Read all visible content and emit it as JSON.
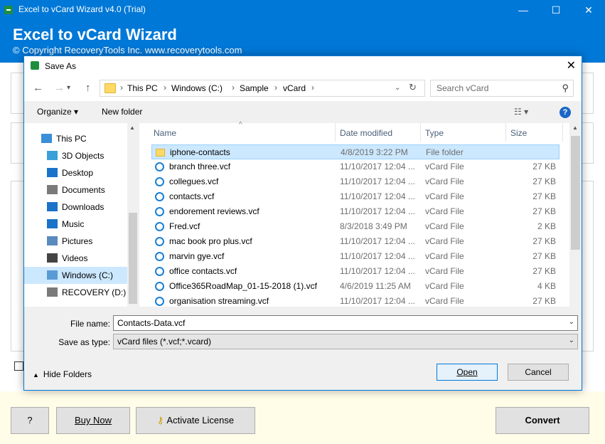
{
  "app": {
    "window_title": "Excel to vCard Wizard v4.0 (Trial)",
    "header_title": "Excel to vCard Wizard",
    "copyright": "© Copyright RecoveryTools Inc. www.recoverytools.com",
    "min_glyph": "—",
    "max_glyph": "☐",
    "close_glyph": "✕",
    "buttons": {
      "help": "?",
      "buy_now": "Buy Now",
      "activate_license": "Activate License",
      "convert": "Convert"
    }
  },
  "dialog": {
    "title": "Save As",
    "close_glyph": "✕",
    "nav": {
      "back": "←",
      "forward": "→",
      "up": "↑"
    },
    "breadcrumb": [
      "This PC",
      "Windows (C:)",
      "Sample",
      "vCard"
    ],
    "search_placeholder": "Search vCard",
    "toolbar": {
      "organize": "Organize ▾",
      "new_folder": "New folder",
      "view": "☷ ▾",
      "help": "?"
    },
    "nav_pane": [
      {
        "label": "This PC",
        "icon": "computer-icon",
        "color": "#3b8ed8"
      },
      {
        "label": "3D Objects",
        "icon": "cube-icon",
        "color": "#39a0d8"
      },
      {
        "label": "Desktop",
        "icon": "desktop-icon",
        "color": "#1a73c8"
      },
      {
        "label": "Documents",
        "icon": "document-icon",
        "color": "#7a7a7a"
      },
      {
        "label": "Downloads",
        "icon": "download-icon",
        "color": "#1a73c8"
      },
      {
        "label": "Music",
        "icon": "music-icon",
        "color": "#1a73c8"
      },
      {
        "label": "Pictures",
        "icon": "picture-icon",
        "color": "#5a8bbf"
      },
      {
        "label": "Videos",
        "icon": "video-icon",
        "color": "#444444"
      },
      {
        "label": "Windows (C:)",
        "icon": "drive-icon",
        "color": "#5b9bd5",
        "selected": true
      },
      {
        "label": "RECOVERY (D:)",
        "icon": "drive-icon",
        "color": "#7a7a7a"
      }
    ],
    "columns": {
      "name": "Name",
      "date": "Date modified",
      "type": "Type",
      "size": "Size"
    },
    "files": [
      {
        "name": "iphone-contacts",
        "date": "4/8/2019 3:22 PM",
        "type": "File folder",
        "size": "",
        "icon": "folder-icon",
        "selected": true
      },
      {
        "name": "branch three.vcf",
        "date": "11/10/2017 12:04 ...",
        "type": "vCard File",
        "size": "27 KB",
        "icon": "vcard-icon"
      },
      {
        "name": "collegues.vcf",
        "date": "11/10/2017 12:04 ...",
        "type": "vCard File",
        "size": "27 KB",
        "icon": "vcard-icon"
      },
      {
        "name": "contacts.vcf",
        "date": "11/10/2017 12:04 ...",
        "type": "vCard File",
        "size": "27 KB",
        "icon": "vcard-icon"
      },
      {
        "name": "endorement reviews.vcf",
        "date": "11/10/2017 12:04 ...",
        "type": "vCard File",
        "size": "27 KB",
        "icon": "vcard-icon"
      },
      {
        "name": "Fred.vcf",
        "date": "8/3/2018 3:49 PM",
        "type": "vCard File",
        "size": "2 KB",
        "icon": "vcard-icon"
      },
      {
        "name": "mac book pro plus.vcf",
        "date": "11/10/2017 12:04 ...",
        "type": "vCard File",
        "size": "27 KB",
        "icon": "vcard-icon"
      },
      {
        "name": "marvin gye.vcf",
        "date": "11/10/2017 12:04 ...",
        "type": "vCard File",
        "size": "27 KB",
        "icon": "vcard-icon"
      },
      {
        "name": "office contacts.vcf",
        "date": "11/10/2017 12:04 ...",
        "type": "vCard File",
        "size": "27 KB",
        "icon": "vcard-icon"
      },
      {
        "name": "Office365RoadMap_01-15-2018 (1).vcf",
        "date": "4/6/2019 11:25 AM",
        "type": "vCard File",
        "size": "4 KB",
        "icon": "vcard-icon"
      },
      {
        "name": "organisation streaming.vcf",
        "date": "11/10/2017 12:04 ...",
        "type": "vCard File",
        "size": "27 KB",
        "icon": "vcard-icon"
      }
    ],
    "file_name_label": "File name:",
    "file_name_value": "Contacts-Data.vcf",
    "save_type_label": "Save as type:",
    "save_type_value": "vCard files (*.vcf;*.vcard)",
    "hide_folders": "Hide Folders",
    "open_button": "Open",
    "cancel_button": "Cancel"
  },
  "colors": {
    "accent": "#0078d7",
    "selection": "#cce8ff",
    "folder": "#ffd966",
    "bottom_bg": "#fffde8"
  }
}
